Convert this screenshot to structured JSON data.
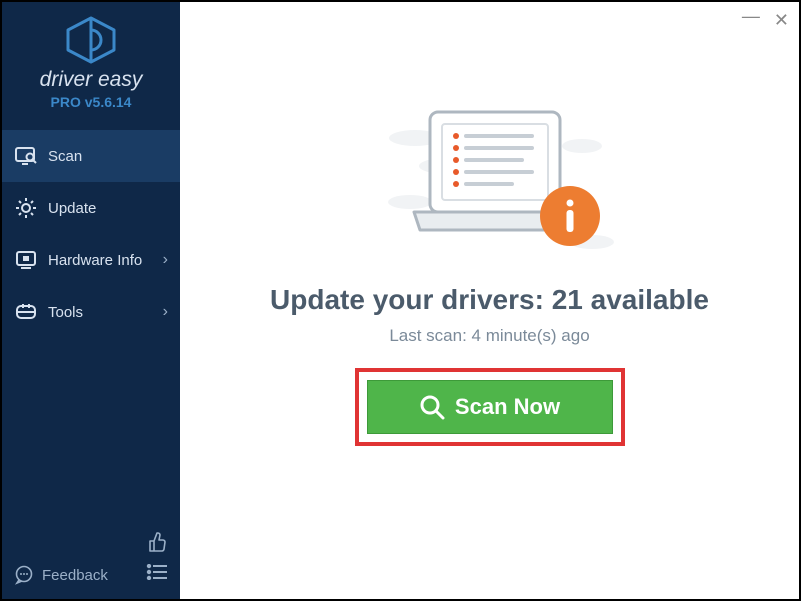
{
  "brand": {
    "name": "driver easy",
    "version_label": "PRO v5.6.14"
  },
  "nav": {
    "scan": "Scan",
    "update": "Update",
    "hardware": "Hardware Info",
    "tools": "Tools"
  },
  "footer": {
    "feedback": "Feedback"
  },
  "main": {
    "headline_prefix": "Update your drivers: ",
    "available_count": 21,
    "headline_suffix": " available",
    "last_scan_prefix": "Last scan: ",
    "last_scan_value": "4 minute(s) ago",
    "scan_button": "Scan Now"
  },
  "colors": {
    "sidebar": "#0f2848",
    "accent": "#3b88c9",
    "headline": "#4b5b6b",
    "button": "#4fb54a",
    "highlight": "#e03434",
    "info_badge": "#ed7d31"
  }
}
